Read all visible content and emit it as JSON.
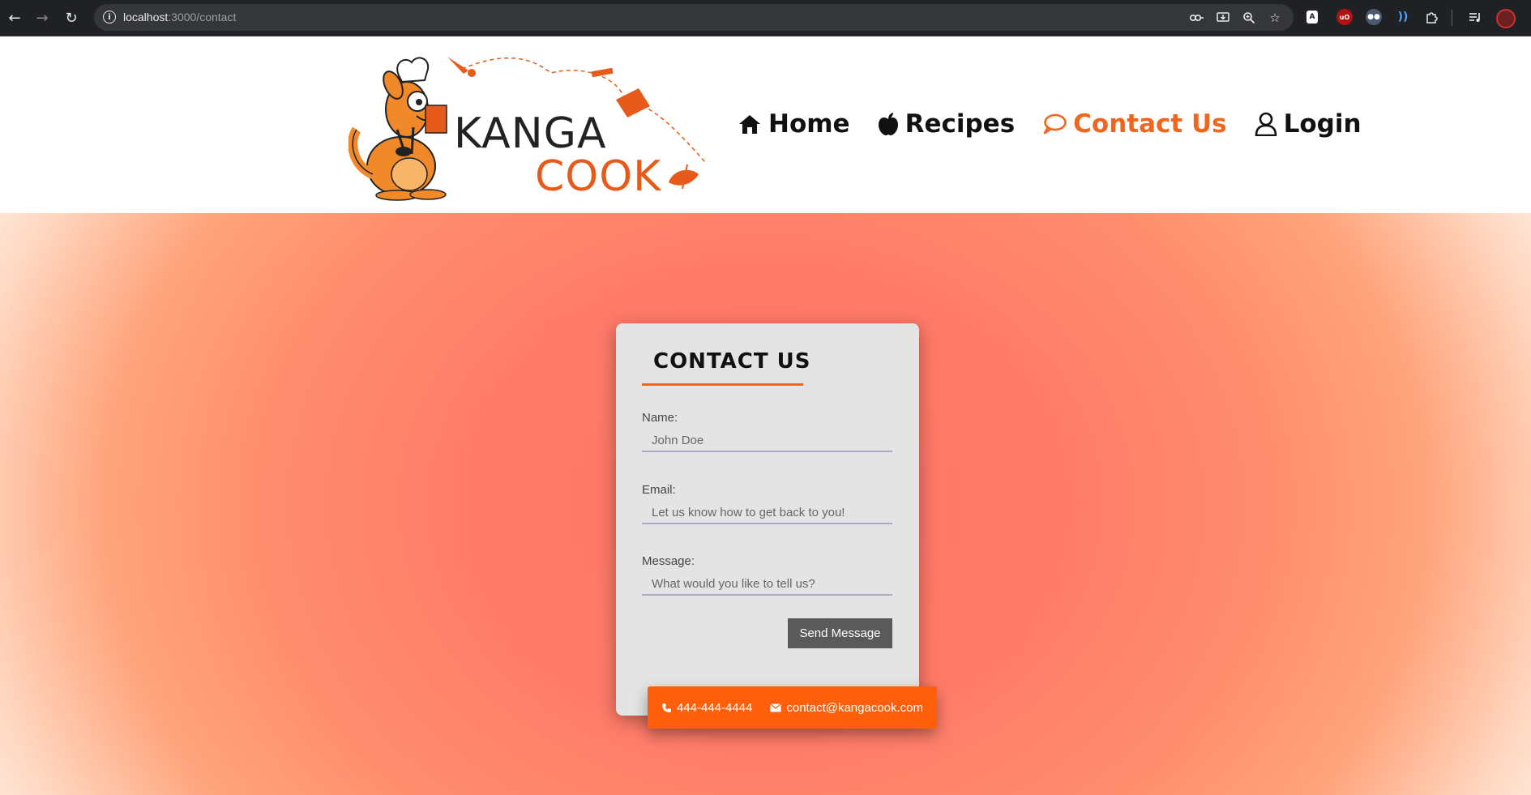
{
  "browser": {
    "url_host": "localhost",
    "url_path": ":3000/contact"
  },
  "logo": {
    "line1": "KANGA",
    "line2": "COOK"
  },
  "nav": {
    "items": [
      {
        "label": "Home",
        "icon": "home-icon"
      },
      {
        "label": "Recipes",
        "icon": "apple-icon"
      },
      {
        "label": "Contact Us",
        "icon": "speech-bubble-icon",
        "active": true
      },
      {
        "label": "Login",
        "icon": "user-icon"
      }
    ]
  },
  "contact_form": {
    "title": "CONTACT US",
    "name_label": "Name:",
    "name_placeholder": "John Doe",
    "email_label": "Email:",
    "email_placeholder": "Let us know how to get back to you!",
    "message_label": "Message:",
    "message_placeholder": "What would you like to tell us?",
    "send_label": "Send Message"
  },
  "contact_info": {
    "phone": "444-444-4444",
    "email": "contact@kangacook.com"
  },
  "colors": {
    "accent": "#f0661e",
    "strip": "#ff5f0a",
    "card": "#e4e4e4",
    "button": "#5a5a5a"
  }
}
